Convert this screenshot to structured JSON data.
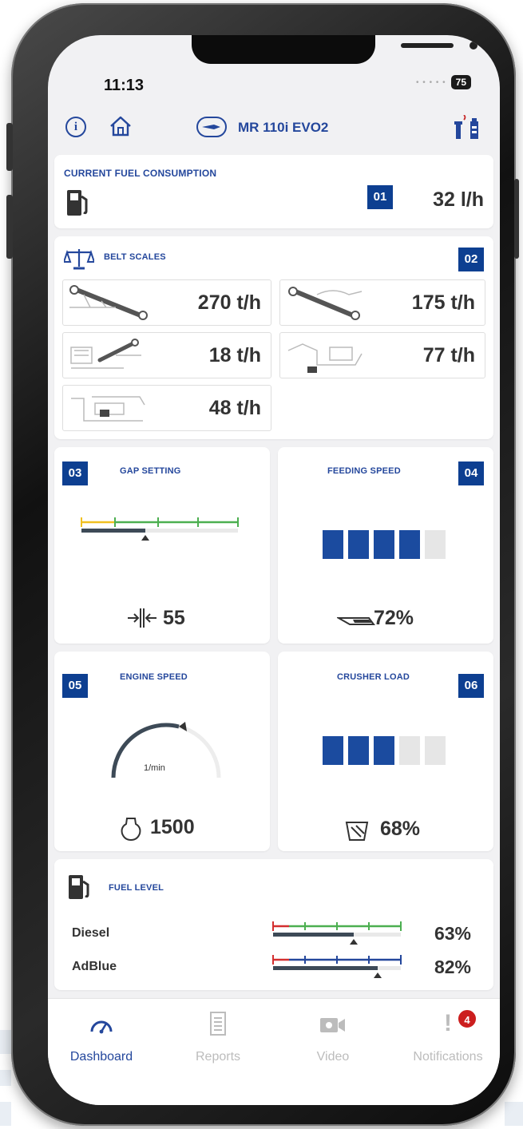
{
  "status": {
    "time": "11:13",
    "battery": "75"
  },
  "header": {
    "machine": "MR 110i EVO2"
  },
  "fuel_consumption": {
    "title": "CURRENT FUEL CONSUMPTION",
    "badge": "01",
    "value": "32 l/h"
  },
  "belt_scales": {
    "title": "BELT SCALES",
    "badge": "02",
    "items": [
      {
        "value": "270 t/h"
      },
      {
        "value": "175 t/h"
      },
      {
        "value": "18 t/h"
      },
      {
        "value": "77 t/h"
      },
      {
        "value": "48 t/h"
      }
    ]
  },
  "gap_setting": {
    "title": "GAP SETTING",
    "badge": "03",
    "value": "55"
  },
  "feeding_speed": {
    "title": "FEEDING SPEED",
    "badge": "04",
    "value": "72%",
    "level_segments": 4,
    "total_segments": 5
  },
  "engine_speed": {
    "title": "ENGINE SPEED",
    "badge": "05",
    "unit": "1/min",
    "value": "1500"
  },
  "crusher_load": {
    "title": "CRUSHER LOAD",
    "badge": "06",
    "value": "68%",
    "level_segments": 3,
    "total_segments": 5
  },
  "fuel_level": {
    "title": "FUEL LEVEL",
    "rows": [
      {
        "label": "Diesel",
        "value": "63%",
        "fraction": 0.63,
        "color": "#4caf50"
      },
      {
        "label": "AdBlue",
        "value": "82%",
        "fraction": 0.82,
        "color": "#24479c"
      }
    ]
  },
  "tabbar": {
    "tabs": [
      {
        "label": "Dashboard",
        "active": true
      },
      {
        "label": "Reports",
        "active": false
      },
      {
        "label": "Video",
        "active": false
      },
      {
        "label": "Notifications",
        "active": false,
        "badge": "4"
      }
    ]
  },
  "colors": {
    "accent": "#24479c",
    "badge": "#0d3f91",
    "segment_on": "#1b4b9f",
    "alert": "#cc1e1e"
  }
}
